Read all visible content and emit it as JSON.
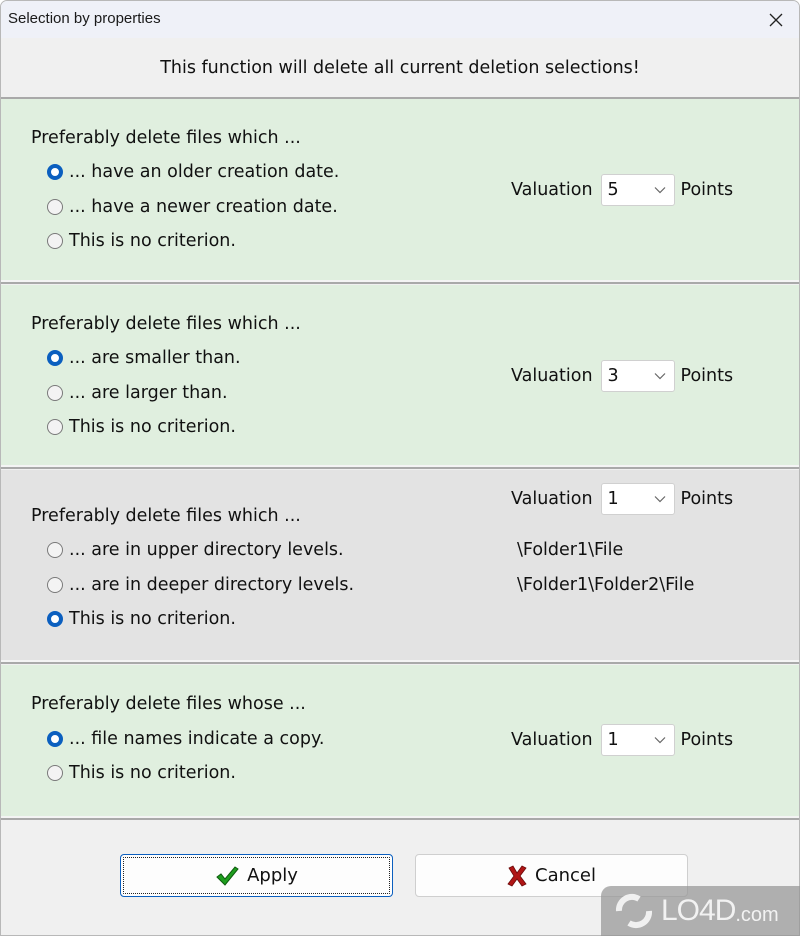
{
  "window": {
    "title": "Selection by properties",
    "close_icon": "close-icon"
  },
  "notice": "This function will delete all current deletion selections!",
  "panels": [
    {
      "heading": "Preferably delete files which ...",
      "options": [
        {
          "label": "... have an older creation date.",
          "checked": true
        },
        {
          "label": "... have a newer creation date.",
          "checked": false
        },
        {
          "label": "This is no criterion.",
          "checked": false
        }
      ],
      "valuation_label": "Valuation",
      "valuation_value": "5",
      "points_label": "Points",
      "background": "#e0efdf"
    },
    {
      "heading": "Preferably delete files which ...",
      "options": [
        {
          "label": "... are smaller than.",
          "checked": true
        },
        {
          "label": "... are larger than.",
          "checked": false
        },
        {
          "label": "This is no criterion.",
          "checked": false
        }
      ],
      "valuation_label": "Valuation",
      "valuation_value": "3",
      "points_label": "Points",
      "background": "#e0efdf"
    },
    {
      "heading": "Preferably delete files which ...",
      "options": [
        {
          "label": "... are in upper directory levels.",
          "checked": false
        },
        {
          "label": "... are in deeper directory levels.",
          "checked": false
        },
        {
          "label": "This is no criterion.",
          "checked": true
        }
      ],
      "valuation_label": "Valuation",
      "valuation_value": "1",
      "points_label": "Points",
      "examples": [
        "\\Folder1\\File",
        "\\Folder1\\Folder2\\File"
      ],
      "background": "#e3e3e3"
    },
    {
      "heading": "Preferably delete files whose ...",
      "options": [
        {
          "label": "... file names indicate a copy.",
          "checked": true
        },
        {
          "label": "This is no criterion.",
          "checked": false
        }
      ],
      "valuation_label": "Valuation",
      "valuation_value": "1",
      "points_label": "Points",
      "background": "#e0efdf"
    }
  ],
  "buttons": {
    "apply": {
      "label": "Apply",
      "icon": "checkmark-icon",
      "color": "#1e9e1e"
    },
    "cancel": {
      "label": "Cancel",
      "icon": "x-icon",
      "color": "#b01515"
    }
  },
  "watermark": {
    "main": "LO4D",
    "sub": ".com"
  },
  "colors": {
    "accent": "#0b5fbf",
    "panel_green": "#e0efdf",
    "panel_gray": "#e3e3e3",
    "dialog_bg": "#f0f0f0"
  }
}
